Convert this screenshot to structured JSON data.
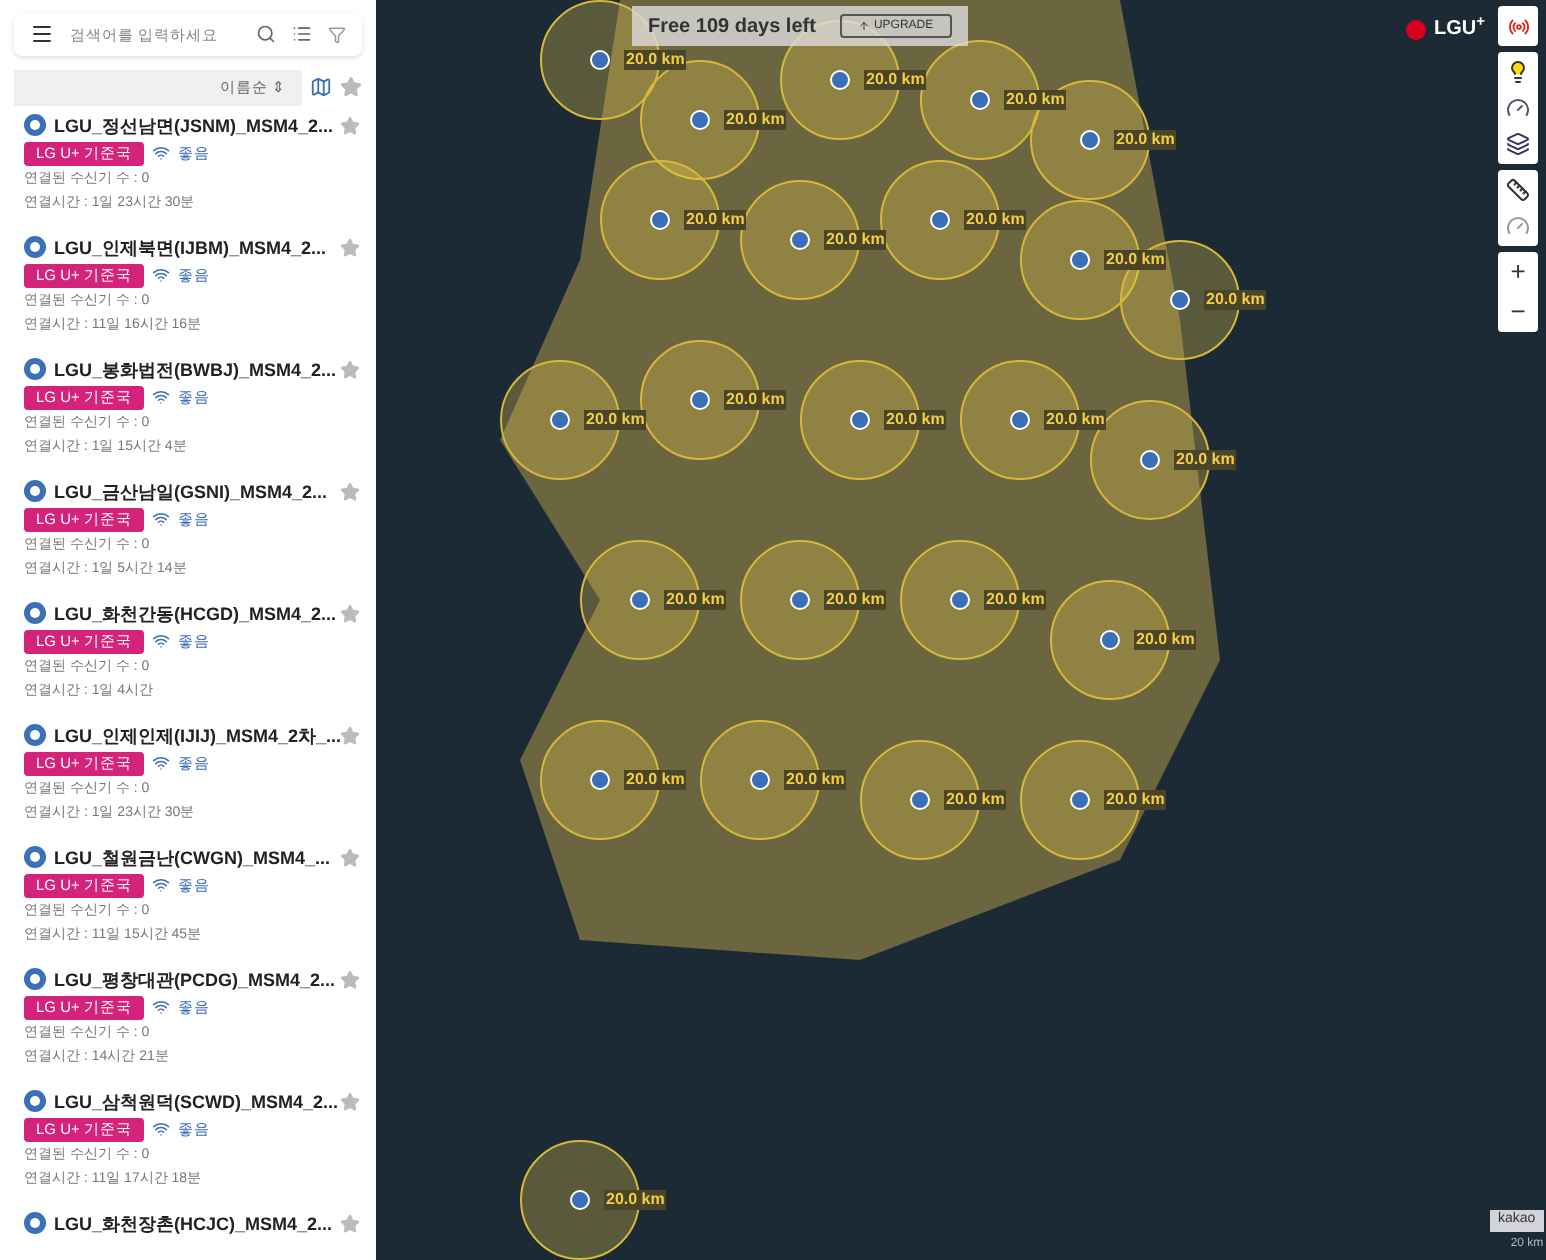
{
  "search": {
    "placeholder": "검색어를 입력하세요"
  },
  "sort": {
    "label": "이름순 ⇕"
  },
  "stations": [
    {
      "name": "LGU_정선남면(JSNM)_MSM4_2...",
      "badge": "LG U+ 기준국",
      "signal": "좋음",
      "receivers": "연결된 수신기 수 : 0",
      "uptime": "연결시간 : 1일 23시간 30분",
      "starred": false
    },
    {
      "name": "LGU_인제북면(IJBM)_MSM4_2...",
      "badge": "LG U+ 기준국",
      "signal": "좋음",
      "receivers": "연결된 수신기 수 : 0",
      "uptime": "연결시간 : 11일 16시간 16분",
      "starred": false
    },
    {
      "name": "LGU_봉화법전(BWBJ)_MSM4_2...",
      "badge": "LG U+ 기준국",
      "signal": "좋음",
      "receivers": "연결된 수신기 수 : 0",
      "uptime": "연결시간 : 1일 15시간 4분",
      "starred": false
    },
    {
      "name": "LGU_금산남일(GSNI)_MSM4_2...",
      "badge": "LG U+ 기준국",
      "signal": "좋음",
      "receivers": "연결된 수신기 수 : 0",
      "uptime": "연결시간 : 1일 5시간 14분",
      "starred": false
    },
    {
      "name": "LGU_화천간동(HCGD)_MSM4_2...",
      "badge": "LG U+ 기준국",
      "signal": "좋음",
      "receivers": "연결된 수신기 수 : 0",
      "uptime": "연결시간 : 1일 4시간",
      "starred": false
    },
    {
      "name": "LGU_인제인제(IJIJ)_MSM4_2차_...",
      "badge": "LG U+ 기준국",
      "signal": "좋음",
      "receivers": "연결된 수신기 수 : 0",
      "uptime": "연결시간 : 1일 23시간 30분",
      "starred": false
    },
    {
      "name": "LGU_철원금난(CWGN)_MSM4_...",
      "badge": "LG U+ 기준국",
      "signal": "좋음",
      "receivers": "연결된 수신기 수 : 0",
      "uptime": "연결시간 : 11일 15시간 45분",
      "starred": false
    },
    {
      "name": "LGU_평창대관(PCDG)_MSM4_2...",
      "badge": "LG U+ 기준국",
      "signal": "좋음",
      "receivers": "연결된 수신기 수 : 0",
      "uptime": "연결시간 : 14시간 21분",
      "starred": false
    },
    {
      "name": "LGU_삼척원덕(SCWD)_MSM4_2...",
      "badge": "LG U+ 기준국",
      "signal": "좋음",
      "receivers": "연결된 수신기 수 : 0",
      "uptime": "연결시간 : 11일 17시간 18분",
      "starred": false
    },
    {
      "name": "LGU_화천장촌(HCJC)_MSM4_2...",
      "starred": false
    }
  ],
  "banner": {
    "text": "Free 109 days left",
    "button": "UPGRADE"
  },
  "logo": {
    "text": "LGU",
    "sup": "+"
  },
  "coverage": [
    {
      "label": "20.0 km"
    },
    {
      "label": "20.0 km"
    },
    {
      "label": "20.0 km"
    },
    {
      "label": "20.0 km"
    },
    {
      "label": "20.0 km"
    },
    {
      "label": "20.0 km"
    },
    {
      "label": "20.0 km"
    },
    {
      "label": "20.0 km"
    },
    {
      "label": "20.0 km"
    },
    {
      "label": "20.0 km"
    },
    {
      "label": "20.0 km"
    },
    {
      "label": "20.0 km"
    },
    {
      "label": "20.0 km"
    },
    {
      "label": "20.0 km"
    },
    {
      "label": "20.0 km"
    },
    {
      "label": "20.0 km"
    },
    {
      "label": "20.0 km"
    },
    {
      "label": "20.0 km"
    },
    {
      "label": "20.0 km"
    },
    {
      "label": "20.0 km"
    },
    {
      "label": "20.0 km"
    },
    {
      "label": "20.0 km"
    },
    {
      "label": "20.0 km"
    },
    {
      "label": "20.0 km"
    }
  ],
  "zoom": {
    "in": "+",
    "out": "−"
  },
  "attribution": {
    "brand": "kakao",
    "scale": "20 km"
  }
}
